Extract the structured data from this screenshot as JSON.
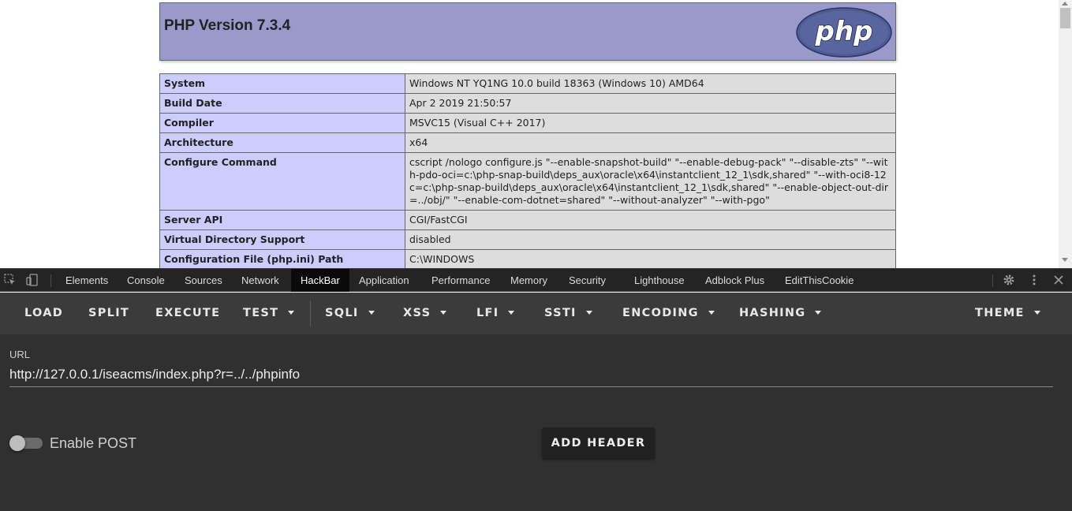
{
  "phpinfo": {
    "title": "PHP Version 7.3.4",
    "logo_text": "php",
    "rows": [
      {
        "key": "System",
        "value": "Windows NT YQ1NG 10.0 build 18363 (Windows 10) AMD64"
      },
      {
        "key": "Build Date",
        "value": "Apr 2 2019 21:50:57"
      },
      {
        "key": "Compiler",
        "value": "MSVC15 (Visual C++ 2017)"
      },
      {
        "key": "Architecture",
        "value": "x64"
      },
      {
        "key": "Configure Command",
        "value": "cscript /nologo configure.js \"--enable-snapshot-build\" \"--enable-debug-pack\" \"--disable-zts\" \"--with-pdo-oci=c:\\php-snap-build\\deps_aux\\oracle\\x64\\instantclient_12_1\\sdk,shared\" \"--with-oci8-12c=c:\\php-snap-build\\deps_aux\\oracle\\x64\\instantclient_12_1\\sdk,shared\" \"--enable-object-out-dir=../obj/\" \"--enable-com-dotnet=shared\" \"--without-analyzer\" \"--with-pgo\""
      },
      {
        "key": "Server API",
        "value": "CGI/FastCGI"
      },
      {
        "key": "Virtual Directory Support",
        "value": "disabled"
      },
      {
        "key": "Configuration File (php.ini) Path",
        "value": "C:\\WINDOWS"
      }
    ]
  },
  "devtools": {
    "tabs": [
      "Elements",
      "Console",
      "Sources",
      "Network",
      "HackBar",
      "Application",
      "Performance",
      "Memory",
      "Security",
      "Lighthouse",
      "Adblock Plus",
      "EditThisCookie"
    ],
    "active_tab": "HackBar"
  },
  "hackbar": {
    "toolbar": {
      "load": "LOAD",
      "split": "SPLIT",
      "execute": "EXECUTE",
      "test": "TEST",
      "sqli": "SQLI",
      "xss": "XSS",
      "lfi": "LFI",
      "ssti": "SSTI",
      "encoding": "ENCODING",
      "hashing": "HASHING",
      "theme": "THEME"
    },
    "url_label": "URL",
    "url_value": "http://127.0.0.1/iseacms/index.php?r=../../phpinfo",
    "enable_post_label": "Enable POST",
    "enable_post_checked": false,
    "add_header_label": "ADD HEADER"
  },
  "colors": {
    "php_header_bg": "#9999cc",
    "table_key_bg": "#ccccff",
    "table_value_bg": "#dddddd",
    "devtools_bar_bg": "#242424",
    "hackbar_toolbar_bg": "#3b3b3b",
    "hackbar_body_bg": "#303030"
  }
}
